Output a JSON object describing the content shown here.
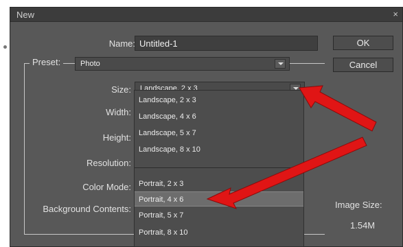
{
  "window": {
    "title": "New",
    "close": "×"
  },
  "labels": {
    "name": "Name:",
    "preset": "Preset:",
    "size": "Size:",
    "width": "Width:",
    "height": "Height:",
    "resolution": "Resolution:",
    "color_mode": "Color Mode:",
    "background_contents": "Background Contents:"
  },
  "fields": {
    "name_value": "Untitled-1",
    "preset_value": "Photo",
    "size_value": "Landscape, 2 x 3"
  },
  "buttons": {
    "ok": "OK",
    "cancel": "Cancel"
  },
  "dropdown": {
    "options": [
      "Landscape, 2 x 3",
      "Landscape, 4 x 6",
      "Landscape, 5 x 7",
      "Landscape, 8 x 10",
      "Portrait, 2 x 3",
      "Portrait, 4 x 6",
      "Portrait, 5 x 7",
      "Portrait, 8 x 10"
    ],
    "selected": "Portrait, 4 x 6"
  },
  "image_size": {
    "label": "Image Size:",
    "value": "1.54M"
  },
  "colors": {
    "annotation_arrow": "#e01515"
  },
  "icons": {
    "dropdown_caret": "chevron-down-icon",
    "close": "close-icon"
  }
}
